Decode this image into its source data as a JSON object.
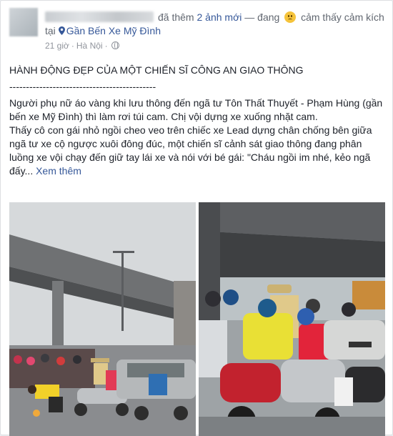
{
  "header": {
    "action_text": "đã thêm",
    "photos_added": "2 ảnh mới",
    "feeling_prefix": "— đang",
    "feeling_text": "cảm thấy cảm kích tại",
    "location": "Gần Bến Xe Mỹ Đình"
  },
  "meta": {
    "time": "21 giờ",
    "place": "Hà Nội",
    "separator": "·"
  },
  "post": {
    "title": "HÀNH ĐỘNG ĐẸP CỦA MỘT CHIẾN SĨ CÔNG AN GIAO THÔNG",
    "divider": "--------------------------------------------",
    "paragraph1": "Người phụ nữ áo vàng khi lưu thông đến ngã tư Tôn Thất Thuyết - Phạm Hùng (gần bến xe Mỹ Đình) thì làm rơi túi cam. Chị vội dựng xe xuống nhặt cam.",
    "paragraph2": "Thấy cô con gái nhỏ ngồi cheo veo trên chiếc xe Lead dựng chân chống bên giữa ngã tư xe cộ ngược xuôi đông đúc, một chiến sĩ cảnh sát giao thông đang phân luồng xe vội chạy đến giữ tay lái xe và nói với bé gái: \"Cháu ngồi im nhé, kẻo ngã đấy...",
    "see_more": "Xem thêm"
  },
  "colors": {
    "link": "#365899",
    "meta_text": "#90949c",
    "body_text": "#1d2129",
    "police_uniform": "#e0c98a"
  },
  "icons": {
    "emoji": "smiling-face-icon",
    "location": "map-pin-icon",
    "privacy": "globe-icon"
  }
}
